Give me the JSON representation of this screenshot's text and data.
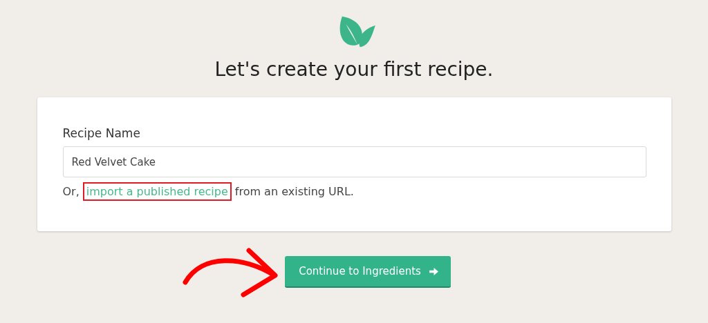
{
  "heading": "Let's create your first recipe.",
  "form": {
    "label": "Recipe Name",
    "value": "Red Velvet Cake",
    "import_line": {
      "prefix": "Or,",
      "link": "import a published recipe",
      "suffix": "from an existing URL.",
      "link_highlighted": true
    }
  },
  "button": {
    "label": "Continue to Ingredients"
  }
}
